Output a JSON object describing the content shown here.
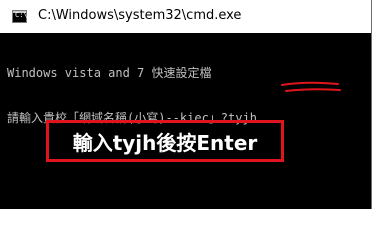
{
  "window": {
    "title": "C:\\Windows\\system32\\cmd.exe",
    "icon": "cmd-console-icon",
    "icon_glyph": "C:\\"
  },
  "console": {
    "lines": [
      "Windows vista and 7 快速設定檔",
      "請輸入貴校「網域名稱(小寫)--kiec」?tyjh"
    ]
  },
  "annotation": {
    "text": "輸入tyjh後按Enter",
    "box_color": "#e0141c",
    "underline_color": "#e0141c"
  }
}
